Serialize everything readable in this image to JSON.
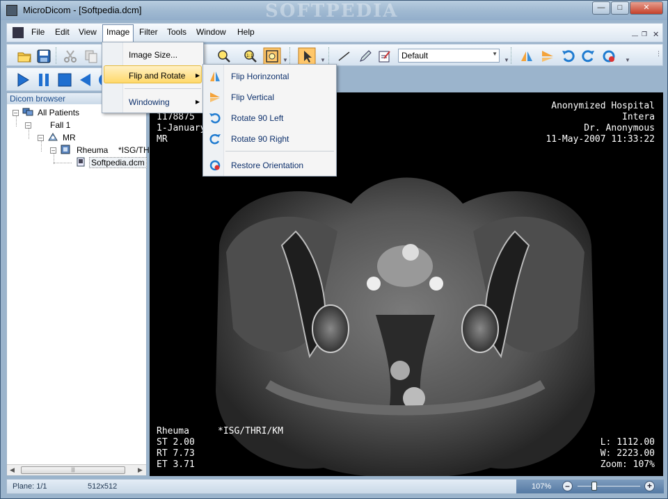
{
  "window": {
    "title": "MicroDicom - [Softpedia.dcm]",
    "watermark": "SOFTPEDIA",
    "controls": [
      "minimize",
      "maximize",
      "close"
    ]
  },
  "menubar": {
    "items": [
      "File",
      "Edit",
      "View",
      "Image",
      "Filter",
      "Tools",
      "Window",
      "Help"
    ],
    "active": "Image"
  },
  "toolbar": {
    "preset_combo": "Default"
  },
  "image_menu": {
    "items": [
      {
        "label": "Image Size...",
        "has_submenu": false
      },
      {
        "label": "Flip and Rotate",
        "has_submenu": true,
        "highlighted": true
      },
      {
        "label": "Windowing",
        "has_submenu": true
      }
    ]
  },
  "flip_rotate_submenu": {
    "items": [
      {
        "label": "Flip Horinzontal",
        "icon": "flip-horizontal-icon"
      },
      {
        "label": "Flip Vertical",
        "icon": "flip-vertical-icon"
      },
      {
        "label": "Rotate 90 Left",
        "icon": "rotate-left-icon"
      },
      {
        "label": "Rotate 90 Right",
        "icon": "rotate-right-icon"
      },
      {
        "label": "Restore Orientation",
        "icon": "restore-orientation-icon"
      }
    ]
  },
  "browser": {
    "title": "Dicom browser",
    "tree": {
      "root": "All Patients",
      "patient": "Fall 1",
      "modality": "MR",
      "series": "Rheuma",
      "series_desc": "*ISG/THI",
      "file": "Softpedia.dcm"
    }
  },
  "viewer": {
    "top_left": [
      "1178875",
      "1-January",
      "MR"
    ],
    "top_right": [
      "Anonymized Hospital",
      "Intera",
      "Dr. Anonymous",
      "11-May-2007 11:33:22"
    ],
    "bottom_left_title": "Rheuma",
    "bottom_left_desc": "*ISG/THRI/KM",
    "bottom_left": [
      "ST 2.00",
      "RT 7.73",
      "ET 3.71"
    ],
    "bottom_right": [
      "L: 1112.00",
      "W: 2223.00",
      "Zoom: 107%"
    ]
  },
  "statusbar": {
    "plane": "Plane: 1/1",
    "size": "512x512",
    "zoom": "107%",
    "zoom_level": 1.07
  }
}
